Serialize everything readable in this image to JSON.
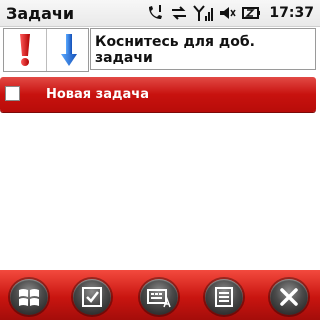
{
  "status_bar": {
    "title": "Задачи",
    "time": "17:37",
    "icons": [
      "phone-signal-icon",
      "sync-icon",
      "signal-strength-icon",
      "speaker-icon",
      "battery-icon"
    ]
  },
  "entry": {
    "high_priority_icon": "exclamation-icon",
    "low_priority_icon": "down-arrow-icon",
    "placeholder": "Коснитесь для доб. задачи"
  },
  "tasks": [
    {
      "label": "Новая задача",
      "checked": false
    }
  ],
  "toolbar": {
    "buttons": [
      "windows-start-icon",
      "checkmark-icon",
      "keyboard-icon",
      "menu-list-icon",
      "close-icon"
    ]
  },
  "colors": {
    "accent_red": "#c8120f",
    "toolbar_red": "#e02a22"
  }
}
